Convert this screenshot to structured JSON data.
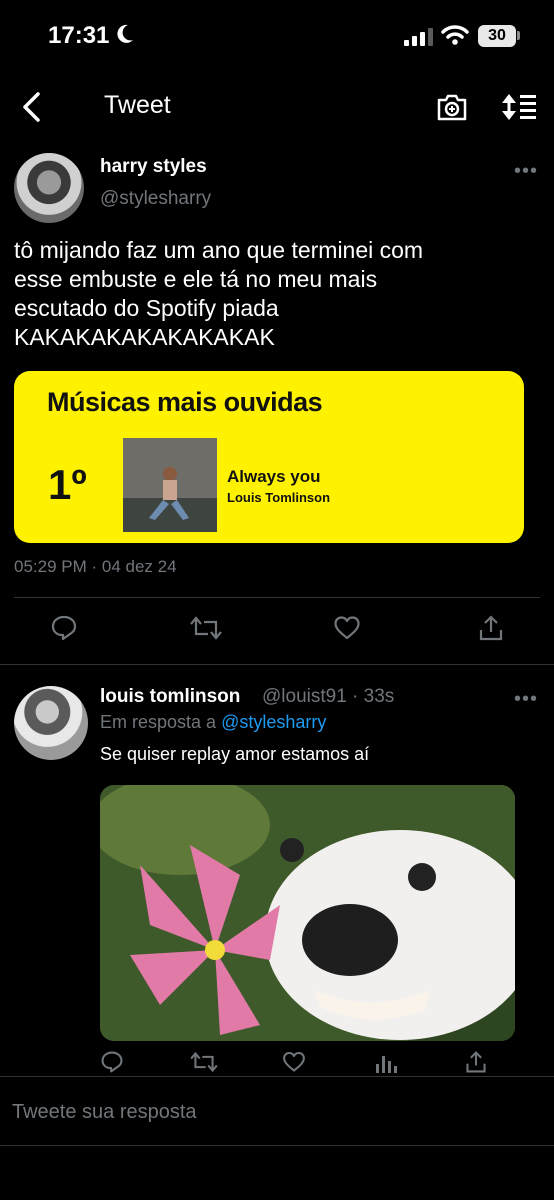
{
  "status_bar": {
    "time": "17:31",
    "battery": "30"
  },
  "header": {
    "title": "Tweet"
  },
  "tweet": {
    "author_name": "harry styles",
    "author_handle": "@stylesharry",
    "more": "•••",
    "text_lines": [
      "tô mijando faz um ano que terminei com",
      "esse embuste e ele tá no meu mais",
      "escutado do Spotify piada",
      "KAKAKAKAKAKAKAKAK"
    ],
    "card": {
      "title": "Músicas mais ouvidas",
      "rank": "1º",
      "song": "Always you",
      "artist": "Louis Tomlinson"
    },
    "timestamp": "05:29 PM · 04 dez 24"
  },
  "reply": {
    "author_name": "louis tomlinson",
    "handle_time": "@louist91 · 33s",
    "more": "•••",
    "reply_prefix": "Em resposta a ",
    "reply_mention": "@stylesharry",
    "text": "Se quiser replay amor estamos aí"
  },
  "composer": {
    "placeholder": "Tweete sua resposta"
  },
  "colors": {
    "background": "#000000",
    "text": "#e7e9ea",
    "muted": "#71767b",
    "accent": "#1d9bf0",
    "card_yellow": "#fff200"
  },
  "icons": [
    "moon-icon",
    "signal-icon",
    "wifi-icon",
    "back-icon",
    "camera-icon",
    "sort-icon",
    "reply-icon",
    "retweet-icon",
    "like-icon",
    "share-icon",
    "views-icon"
  ]
}
